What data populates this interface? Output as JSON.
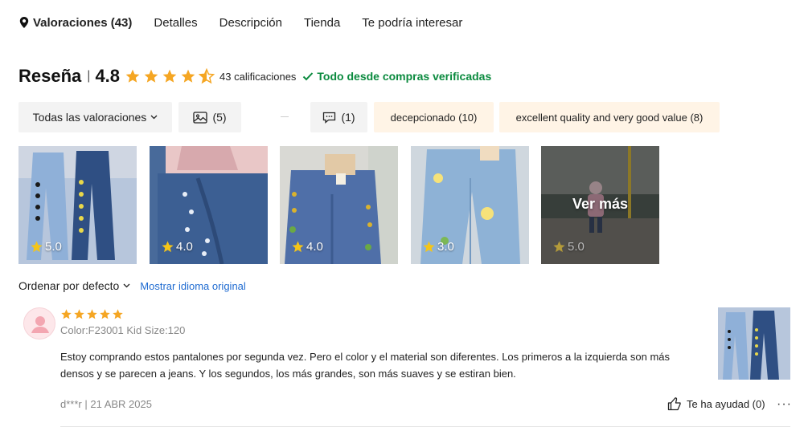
{
  "tabs": [
    {
      "label": "Valoraciones (43)",
      "active": true
    },
    {
      "label": "Detalles"
    },
    {
      "label": "Descripción"
    },
    {
      "label": "Tienda"
    },
    {
      "label": "Te podría interesar"
    }
  ],
  "header": {
    "title": "Reseña",
    "separator": "|",
    "rating": "4.8",
    "stars": 4.5,
    "count_label": "43 calificaciones",
    "verified_label": "Todo desde compras verificadas",
    "star_color": "#f5a623",
    "verified_color": "#0a8a3e"
  },
  "filters": {
    "all_label": "Todas las valoraciones",
    "photos_count": "(5)",
    "comments_count": "(1)",
    "tags": [
      "decepcionado (10)",
      "excellent quality and very good value (8)"
    ]
  },
  "thumbnails": [
    {
      "score": "5.0"
    },
    {
      "score": "4.0"
    },
    {
      "score": "4.0"
    },
    {
      "score": "3.0"
    },
    {
      "score": "5.0",
      "overlay": "Ver más"
    }
  ],
  "sort": {
    "label": "Ordenar por defecto",
    "original_language": "Mostrar idioma original"
  },
  "review": {
    "stars": 5,
    "variant": "Color:F23001 Kid Size:120",
    "text": "Estoy comprando estos pantalones por segunda vez. Pero el color y el material son diferentes. Los primeros a la izquierda son más densos y se parecen a jeans. Y los segundos, los más grandes, son más suaves y se estiran bien.",
    "meta": "d***r | 21 ABR 2025",
    "helpful": "Te ha ayudad (0)",
    "more": "···"
  },
  "icons": [
    "location-pin-icon",
    "star-icon",
    "check-icon",
    "chevron-down-icon",
    "image-icon",
    "comment-icon",
    "thumbs-up-icon",
    "more-icon"
  ]
}
